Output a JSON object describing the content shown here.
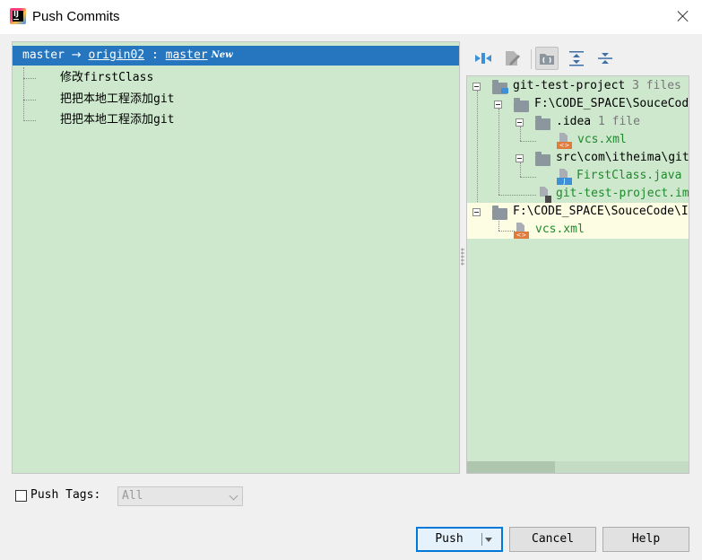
{
  "window": {
    "title": "Push Commits"
  },
  "commits": {
    "header": {
      "local_branch": "master",
      "arrow": "→",
      "remote": "origin02",
      "separator": ":",
      "remote_branch": "master",
      "badge": "New"
    },
    "items": [
      {
        "message": "修改firstClass"
      },
      {
        "message": "把把本地工程添加git"
      },
      {
        "message": "把把本地工程添加git"
      }
    ]
  },
  "toolbar": {
    "icons": [
      "expand-collapse-icon",
      "edit-source-icon",
      "group-by-directory-icon",
      "expand-all-icon",
      "collapse-all-icon"
    ]
  },
  "files": {
    "project": {
      "name": "git-test-project",
      "count": "3 files"
    },
    "root_path": "F:\\CODE_SPACE\\SouceCode\\git-test-project",
    "idea": {
      "name": ".idea",
      "count": "1 file",
      "file": "vcs.xml"
    },
    "src": {
      "name": "src\\com\\itheima\\git",
      "file": "FirstClass.java"
    },
    "iml_file": "git-test-project.iml",
    "second_root": "F:\\CODE_SPACE\\SouceCode\\IdeaProjects",
    "second_file": "vcs.xml"
  },
  "bottom": {
    "push_tags_label": "Push Tags:",
    "push_tags_value": "All",
    "push_label": "Push",
    "cancel_label": "Cancel",
    "help_label": "Help"
  },
  "colors": {
    "selection": "#2675bf",
    "panel_bg": "#cde8cd",
    "changed_file": "#1e8a2b"
  }
}
